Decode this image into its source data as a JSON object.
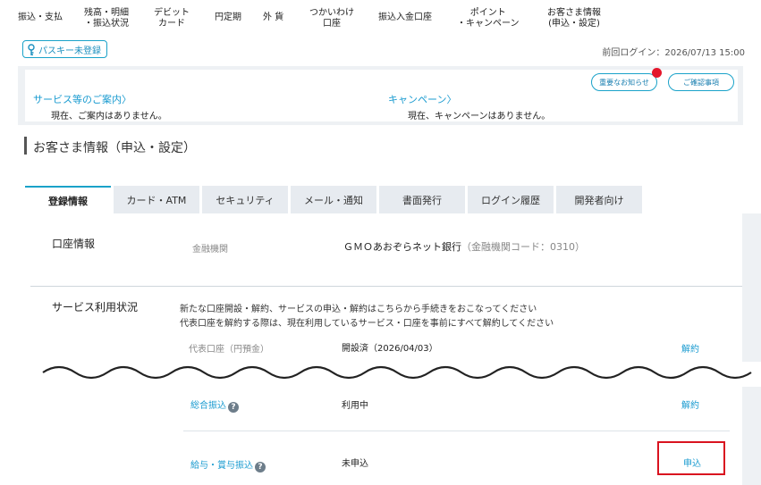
{
  "topnav": {
    "items": [
      {
        "label": "振込・支払"
      },
      {
        "label": "残高・明細\n・振込状況"
      },
      {
        "label": "デビット\nカード"
      },
      {
        "label": "円定期"
      },
      {
        "label": "外 貨"
      },
      {
        "label": "つかいわけ\n口座"
      },
      {
        "label": "振込入金口座"
      },
      {
        "label": "ポイント\n・キャンペーン"
      },
      {
        "label": "お客さま情報\n(申込・設定)"
      }
    ]
  },
  "passkey": {
    "label": "パスキー未登録",
    "icon": "key-icon"
  },
  "last_login": "前回ログイン：2026/07/13 15:00",
  "notice": {
    "important_button": "重要なお知らせ",
    "confirm_button": "ご確認事項",
    "service_link": "サービス等のご案内",
    "service_text": "現在、ご案内はありません。",
    "campaign_link": "キャンペーン",
    "campaign_text": "現在、キャンペーンはありません。"
  },
  "page_title": "お客さま情報（申込・設定）",
  "tabs": [
    {
      "label": "登録情報"
    },
    {
      "label": "カード・ATM"
    },
    {
      "label": "セキュリティ"
    },
    {
      "label": "メール・通知"
    },
    {
      "label": "書面発行"
    },
    {
      "label": "ログイン履歴"
    },
    {
      "label": "開発者向け"
    }
  ],
  "account_info": {
    "heading": "口座情報",
    "field_label": "金融機関",
    "bank_name": "ＧＭＯあおぞらネット銀行",
    "bank_code": "（金融機関コード：0310）"
  },
  "service_status": {
    "heading": "サービス利用状況",
    "desc_line1": "新たな口座開設・解約、サービスの申込・解約はこちらから手続きをおこなってください",
    "desc_line2": "代表口座を解約する際は、現在利用しているサービス・口座を事前にすべて解約してください",
    "rows": [
      {
        "label": "代表口座（円預金）",
        "status": "開設済（2026/04/03）",
        "action": "解約"
      },
      {
        "label": "総合振込",
        "status": "利用中",
        "action": "解約"
      },
      {
        "label": "給与・賞与振込",
        "status": "未申込",
        "action": "申込"
      }
    ]
  },
  "colors": {
    "accent": "#1aa2c9",
    "highlight": "#d9131f",
    "alert_dot": "#e4162b"
  }
}
